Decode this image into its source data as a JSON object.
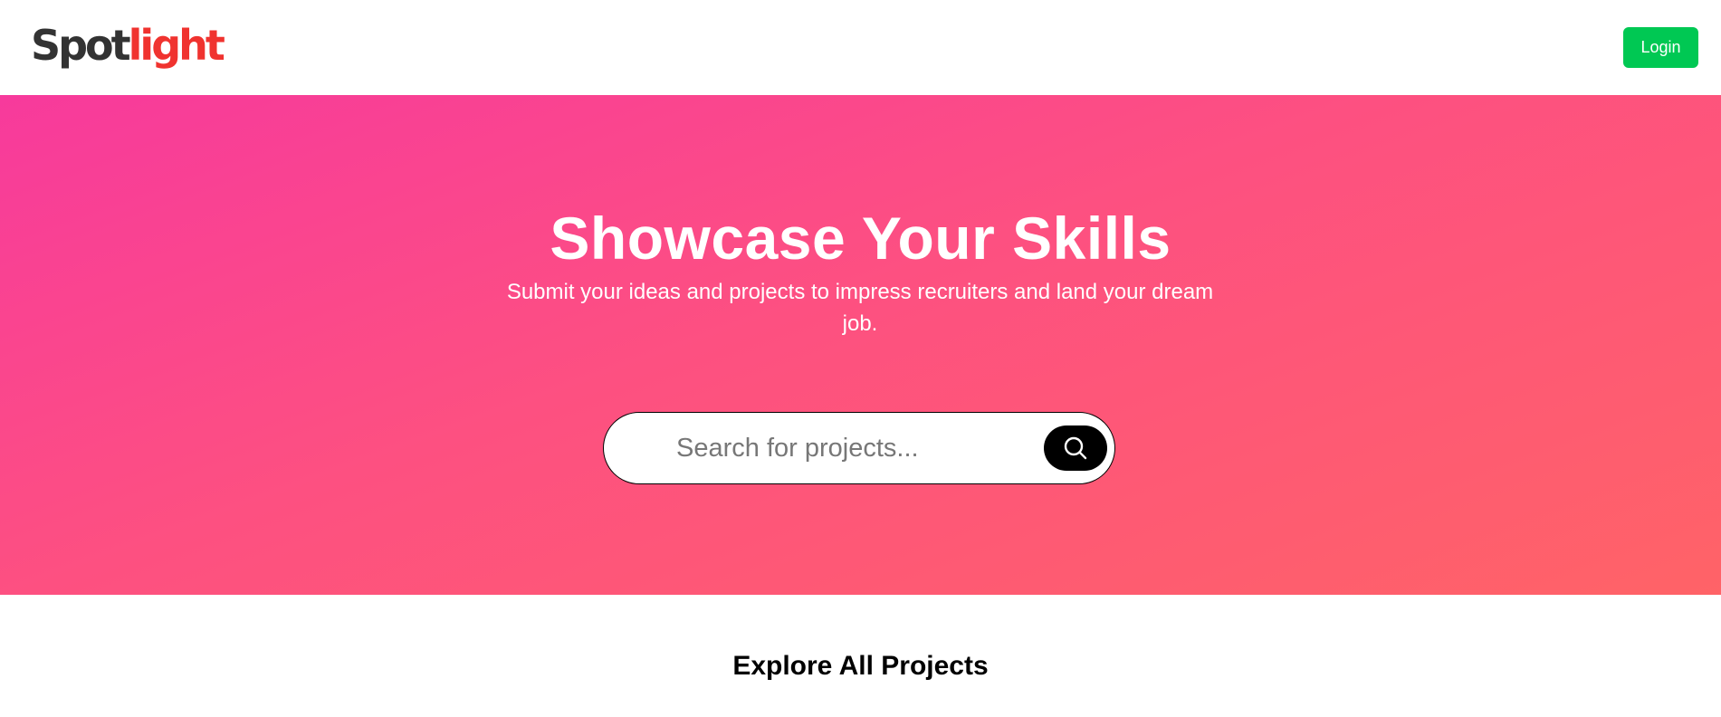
{
  "header": {
    "logo_part1": "Spot",
    "logo_part2": "light",
    "login_label": "Login"
  },
  "hero": {
    "title": "Showcase Your Skills",
    "subtitle": "Submit your ideas and projects to impress recruiters and land your dream job.",
    "search": {
      "placeholder": "Search for projects...",
      "value": "",
      "button_icon": "search-icon"
    }
  },
  "explore": {
    "title": "Explore All Projects"
  },
  "colors": {
    "logo_dark": "#333333",
    "logo_accent": "#f0332f",
    "login_button": "#00c853",
    "hero_gradient_start": "#f73a9c",
    "hero_gradient_end": "#ff6367",
    "search_button": "#000000"
  }
}
